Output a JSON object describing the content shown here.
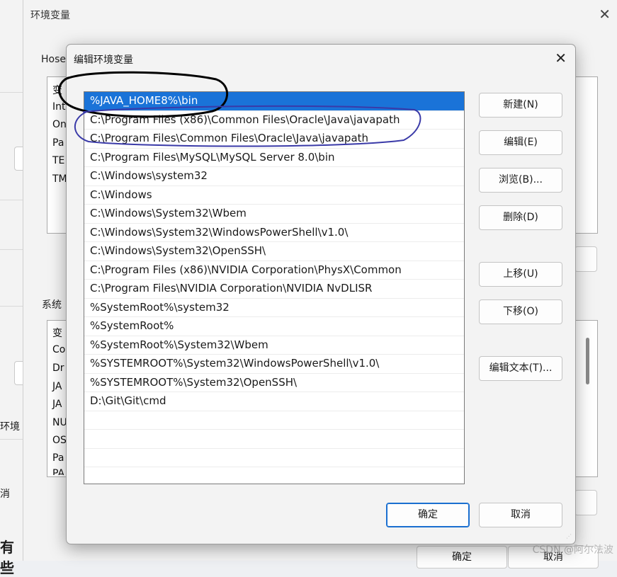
{
  "background_window": {
    "partial_texts": [
      "环境",
      "消",
      "有些"
    ]
  },
  "env_window": {
    "title": "环境变量",
    "user_group_label": "Hose",
    "user_rows": [
      "变",
      "Int",
      "On",
      "Pa",
      "TE",
      "TM"
    ],
    "system_group_label": "系统",
    "system_rows": [
      "变",
      "Co",
      "Dr",
      "JA",
      "JA",
      "NU",
      "OS",
      "Pa",
      "PA"
    ],
    "ok_label": "确定",
    "cancel_label": "取消"
  },
  "dialog": {
    "title": "编辑环境变量",
    "paths": [
      "%JAVA_HOME8%\\bin",
      "C:\\Program Files (x86)\\Common Files\\Oracle\\Java\\javapath",
      "C:\\Program Files\\Common Files\\Oracle\\Java\\javapath",
      "C:\\Program Files\\MySQL\\MySQL Server 8.0\\bin",
      "C:\\Windows\\system32",
      "C:\\Windows",
      "C:\\Windows\\System32\\Wbem",
      "C:\\Windows\\System32\\WindowsPowerShell\\v1.0\\",
      "C:\\Windows\\System32\\OpenSSH\\",
      "C:\\Program Files (x86)\\NVIDIA Corporation\\PhysX\\Common",
      "C:\\Program Files\\NVIDIA Corporation\\NVIDIA NvDLISR",
      "%SystemRoot%\\system32",
      "%SystemRoot%",
      "%SystemRoot%\\System32\\Wbem",
      "%SYSTEMROOT%\\System32\\WindowsPowerShell\\v1.0\\",
      "%SYSTEMROOT%\\System32\\OpenSSH\\",
      "D:\\Git\\Git\\cmd"
    ],
    "selected_index": 0,
    "buttons": {
      "new": "新建(N)",
      "edit": "编辑(E)",
      "browse": "浏览(B)...",
      "delete": "删除(D)",
      "move_up": "上移(U)",
      "move_down": "下移(O)",
      "edit_text": "编辑文本(T)...",
      "ok": "确定",
      "cancel": "取消"
    }
  },
  "watermark": "CSDN @阿尔法波",
  "colors": {
    "selection": "#1a73d8",
    "black_annotation": "#000000",
    "blue_annotation": "#3a3aa8"
  }
}
